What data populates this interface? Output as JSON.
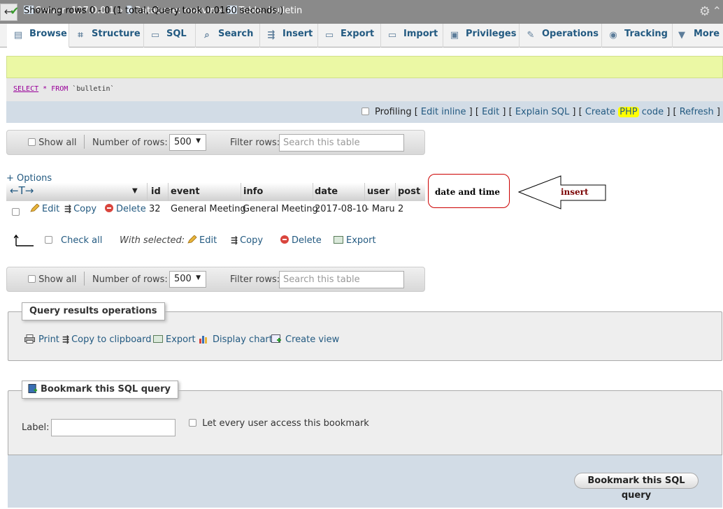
{
  "breadcrumb": {
    "server": "Server: 127.0.0.1",
    "sep1": "»",
    "database": "Database: marvin",
    "sep2": "»",
    "table": "Table: bulletin"
  },
  "tabs": [
    {
      "label": "Browse",
      "icon": "browse-icon",
      "active": true
    },
    {
      "label": "Structure",
      "icon": "structure-icon"
    },
    {
      "label": "SQL",
      "icon": "sql-icon"
    },
    {
      "label": "Search",
      "icon": "search-icon"
    },
    {
      "label": "Insert",
      "icon": "insert-icon"
    },
    {
      "label": "Export",
      "icon": "export-icon"
    },
    {
      "label": "Import",
      "icon": "import-icon"
    },
    {
      "label": "Privileges",
      "icon": "privileges-icon"
    },
    {
      "label": "Operations",
      "icon": "wrench-icon"
    },
    {
      "label": "Tracking",
      "icon": "eye-icon"
    },
    {
      "label": "More",
      "icon": "triangle-down-icon"
    }
  ],
  "success": {
    "message": "Showing rows 0 - 0 (1 total, Query took 0.0160 seconds.)"
  },
  "sql": {
    "keyword_select": "SELECT",
    "rest_1": " * ",
    "keyword_from": "FROM",
    "rest_2": " `bulletin`"
  },
  "profiling": {
    "label": "Profiling",
    "edit_inline": "Edit inline",
    "edit": "Edit",
    "explain": "Explain SQL",
    "create": "Create",
    "php": "PHP",
    "code": "code",
    "refresh": "Refresh"
  },
  "nav": {
    "show_all": "Show all",
    "rows_label": "Number of rows:",
    "rows_value": "500",
    "filter_label": "Filter rows:",
    "search_placeholder": "Search this table"
  },
  "table": {
    "options_link": "+ Options",
    "columns": [
      "id",
      "event",
      "info",
      "date",
      "user",
      "post"
    ],
    "row": {
      "actions": {
        "edit": "Edit",
        "copy": "Copy",
        "delete": "Delete"
      },
      "cells": [
        "32",
        "General Meeting",
        "General Meeting",
        "2017-08-10",
        "- Maru",
        "2"
      ]
    }
  },
  "bulk": {
    "check_all": "Check all",
    "with_selected": "With selected:",
    "edit": "Edit",
    "copy": "Copy",
    "delete": "Delete",
    "export": "Export"
  },
  "annotation": {
    "box_text": "date and time",
    "arrow_text": "insert"
  },
  "query_ops": {
    "legend": "Query results operations",
    "print": "Print",
    "copy_clipboard": "Copy to clipboard",
    "export": "Export",
    "display_chart": "Display chart",
    "create_view": "Create view"
  },
  "bookmark": {
    "legend": "Bookmark this SQL query",
    "label": "Label:",
    "label_value": "",
    "every_user": "Let every user access this bookmark",
    "button": "Bookmark this SQL query"
  },
  "colors": {
    "link": "#235a81",
    "success_bg": "#ebf8a4",
    "toolbar_bg": "#d2dce6",
    "delete_red": "#d9453d",
    "annotation_red": "#cc0000"
  }
}
